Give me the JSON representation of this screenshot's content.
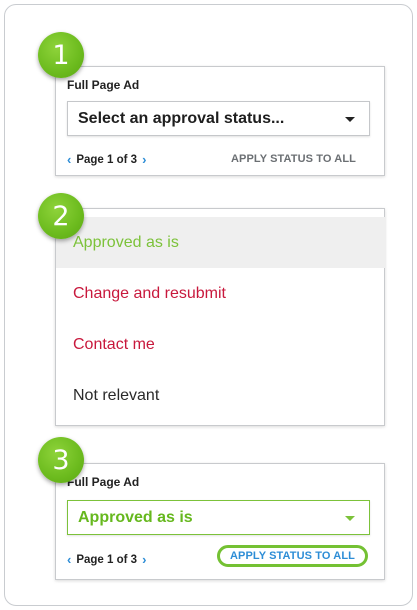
{
  "step1": {
    "badge": "1",
    "label": "Full Page Ad",
    "select_value": "Select an approval status...",
    "pager_prev": "‹",
    "pager_text": "Page 1 of 3",
    "pager_next": "›",
    "apply_label": "APPLY STATUS TO ALL"
  },
  "step2": {
    "badge": "2",
    "options": [
      {
        "label": "Approved as is",
        "color": "#7cc23a"
      },
      {
        "label": "Change and resubmit",
        "color": "#c8183c"
      },
      {
        "label": "Contact me",
        "color": "#c8183c"
      },
      {
        "label": "Not relevant",
        "color": "#2a2a2a"
      }
    ]
  },
  "step3": {
    "badge": "3",
    "label": "Full Page Ad",
    "select_value": "Approved as is",
    "pager_prev": "‹",
    "pager_text": "Page 1 of 3",
    "pager_next": "›",
    "apply_label": "APPLY STATUS TO ALL"
  }
}
